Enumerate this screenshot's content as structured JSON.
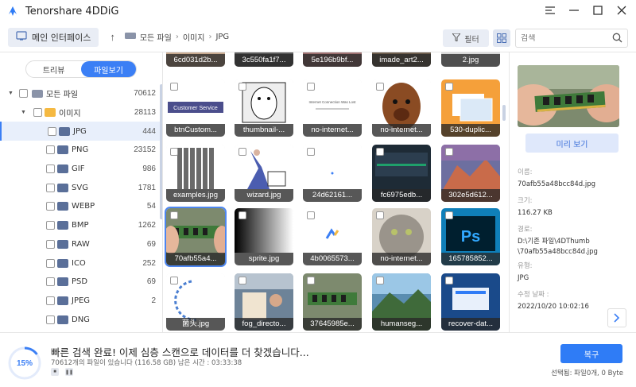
{
  "app": {
    "title": "Tenorshare 4DDiG"
  },
  "toolbar": {
    "home_label": "메인 인터페이스",
    "breadcrumbs": [
      "모든 파일",
      "이미지",
      "JPG"
    ],
    "filter_label": "필터",
    "search_placeholder": "검색"
  },
  "sidebar": {
    "view_tabs": [
      "트리뷰",
      "파일보기"
    ],
    "active_tab": "파일보기",
    "tree": [
      {
        "label": "모든 파일",
        "count": "70612",
        "level": 0,
        "icon": "drive-icon"
      },
      {
        "label": "이미지",
        "count": "28113",
        "level": 1,
        "icon": "folder-icon"
      },
      {
        "label": "JPG",
        "count": "444",
        "level": 2,
        "icon": "folder-icon",
        "selected": true
      },
      {
        "label": "PNG",
        "count": "23152",
        "level": 2,
        "icon": "folder-icon"
      },
      {
        "label": "GIF",
        "count": "986",
        "level": 2,
        "icon": "folder-icon"
      },
      {
        "label": "SVG",
        "count": "1781",
        "level": 2,
        "icon": "folder-icon"
      },
      {
        "label": "WEBP",
        "count": "54",
        "level": 2,
        "icon": "folder-icon"
      },
      {
        "label": "BMP",
        "count": "1262",
        "level": 2,
        "icon": "folder-icon"
      },
      {
        "label": "RAW",
        "count": "69",
        "level": 2,
        "icon": "folder-icon"
      },
      {
        "label": "ICO",
        "count": "252",
        "level": 2,
        "icon": "folder-icon"
      },
      {
        "label": "PSD",
        "count": "69",
        "level": 2,
        "icon": "folder-icon"
      },
      {
        "label": "JPEG",
        "count": "2",
        "level": 2,
        "icon": "folder-icon"
      },
      {
        "label": "DNG",
        "count": "",
        "level": 2,
        "icon": "folder-icon"
      }
    ]
  },
  "grid": {
    "rows": [
      [
        "6cd031d2b...",
        "3c550fa1f7...",
        "5e196b9bf...",
        "imade_art2...",
        "2.jpg"
      ],
      [
        "btnCustom...",
        "thumbnail-...",
        "no-internet...",
        "no-internet...",
        "530-duplic..."
      ],
      [
        "examples.jpg",
        "wizard.jpg",
        "24d62161...",
        "fc6975edb...",
        "302e5d612..."
      ],
      [
        "70afb55a4...",
        "sprite.jpg",
        "4b0065573...",
        "no-internet...",
        "165785852..."
      ],
      [
        "菌头.jpg",
        "fog_directo...",
        "37645985e...",
        "humanseg...",
        "recover-dat..."
      ]
    ],
    "thumb_texts": {
      "customer_service": "Customer Service",
      "no_internet": "Internet Connection Was Lost",
      "ps": "Ps"
    }
  },
  "details": {
    "preview_label": "미리 보기",
    "name_label": "이름:",
    "name_value": "70afb55a48bcc84d.jpg",
    "size_label": "크기:",
    "size_value": "116.27 KB",
    "path_label": "경로:",
    "path_value_1": "D:\\기존 파일\\4DThumb",
    "path_value_2": "\\70afb55a48bcc84d.jpg",
    "type_label": "유형:",
    "type_value": "JPG",
    "date_label": "수정 날짜 :",
    "date_value": "2022/10/20 10:02:16"
  },
  "footer": {
    "progress": "15%",
    "title": "빠른 검색 완료! 이제 심층 스캔으로 데이터를 더 찾겠습니다...",
    "subtitle": "70612개의 파일이 있습니다 (116.58 GB)  남은 시간 : 03:33:38",
    "recover_label": "복구",
    "selected_info": "선택됨: 파일0개, 0 Byte"
  },
  "colors": {
    "accent": "#2f7cf6",
    "selected_bg": "#e8effb"
  }
}
